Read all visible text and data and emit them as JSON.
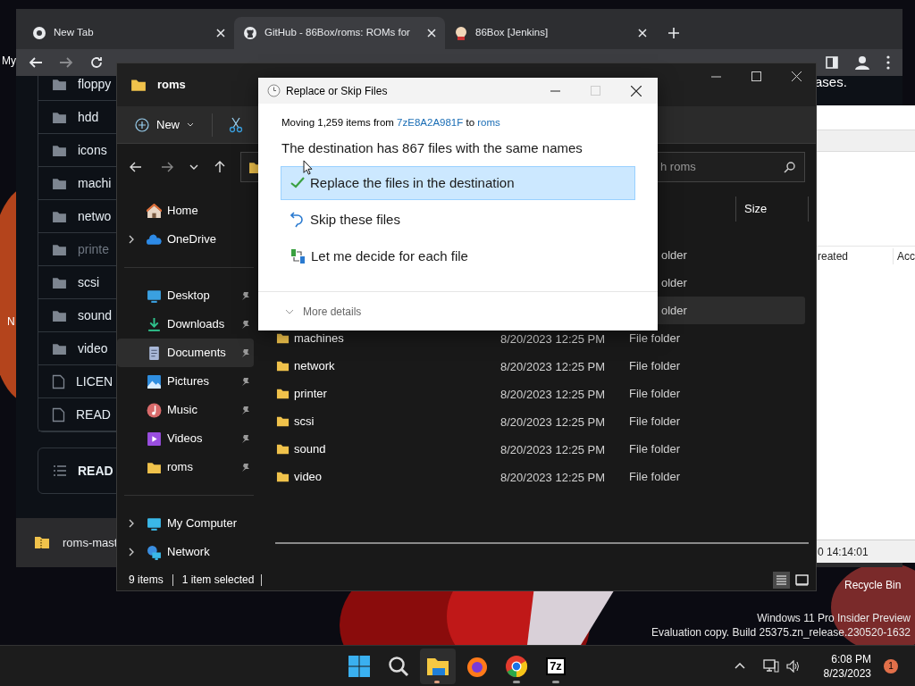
{
  "desktop": {
    "icons": [
      {
        "label": "My"
      },
      {
        "label": "N"
      },
      {
        "label": "Recycle Bin"
      }
    ],
    "watermark": [
      "Windows 11 Pro Insider Preview",
      "Evaluation copy. Build 25375.zn_release.230520-1632"
    ]
  },
  "browser": {
    "tabs": [
      {
        "label": "New Tab",
        "kind": "chrome",
        "selected": false
      },
      {
        "label": "GitHub - 86Box/roms: ROMs for",
        "kind": "github",
        "selected": true
      },
      {
        "label": "86Box [Jenkins]",
        "kind": "jenkins",
        "selected": false
      }
    ],
    "page_text": "ases.",
    "files": [
      {
        "name": "floppy",
        "kind": "folder",
        "dimmed": false
      },
      {
        "name": "hdd",
        "kind": "folder",
        "dimmed": false
      },
      {
        "name": "icons",
        "kind": "folder",
        "dimmed": false
      },
      {
        "name": "machi",
        "kind": "folder",
        "dimmed": false
      },
      {
        "name": "netwo",
        "kind": "folder",
        "dimmed": false
      },
      {
        "name": "printe",
        "kind": "folder",
        "dimmed": true
      },
      {
        "name": "scsi",
        "kind": "folder",
        "dimmed": false
      },
      {
        "name": "sound",
        "kind": "folder",
        "dimmed": false
      },
      {
        "name": "video",
        "kind": "folder",
        "dimmed": false
      },
      {
        "name": "LICEN",
        "kind": "file",
        "dimmed": false
      },
      {
        "name": "READ",
        "kind": "file",
        "dimmed": false
      }
    ],
    "readme_header": "READ",
    "download": "roms-mast"
  },
  "archive_window": {
    "columns": [
      "reated",
      "Acc"
    ],
    "status": "0 14:14:01"
  },
  "explorer": {
    "title": "roms",
    "new_button": "New",
    "search_placeholder": "h roms",
    "size_column": "Size",
    "nav": [
      {
        "label": "Home",
        "kind": "home",
        "expandable": false,
        "pinned": false,
        "selected": false
      },
      {
        "label": "OneDrive",
        "kind": "cloud",
        "expandable": true,
        "pinned": false,
        "selected": false
      },
      {
        "label": "Desktop",
        "kind": "desktop",
        "expandable": false,
        "pinned": true,
        "selected": false
      },
      {
        "label": "Downloads",
        "kind": "download",
        "expandable": false,
        "pinned": true,
        "selected": false
      },
      {
        "label": "Documents",
        "kind": "document",
        "expandable": false,
        "pinned": true,
        "selected": true
      },
      {
        "label": "Pictures",
        "kind": "picture",
        "expandable": false,
        "pinned": true,
        "selected": false
      },
      {
        "label": "Music",
        "kind": "music",
        "expandable": false,
        "pinned": true,
        "selected": false
      },
      {
        "label": "Videos",
        "kind": "video",
        "expandable": false,
        "pinned": true,
        "selected": false
      },
      {
        "label": "roms",
        "kind": "folder",
        "expandable": false,
        "pinned": true,
        "selected": false
      },
      {
        "label": "My Computer",
        "kind": "computer",
        "expandable": true,
        "pinned": false,
        "selected": false
      },
      {
        "label": "Network",
        "kind": "network",
        "expandable": true,
        "pinned": false,
        "selected": false
      }
    ],
    "rows": [
      {
        "type": "older",
        "selected": false
      },
      {
        "type": "older",
        "selected": false
      },
      {
        "type": "older",
        "selected": true
      },
      {
        "name": "machines",
        "date": "8/20/2023 12:25 PM",
        "type": "File folder",
        "selected": false
      },
      {
        "name": "network",
        "date": "8/20/2023 12:25 PM",
        "type": "File folder",
        "selected": false
      },
      {
        "name": "printer",
        "date": "8/20/2023 12:25 PM",
        "type": "File folder",
        "selected": false
      },
      {
        "name": "scsi",
        "date": "8/20/2023 12:25 PM",
        "type": "File folder",
        "selected": false
      },
      {
        "name": "sound",
        "date": "8/20/2023 12:25 PM",
        "type": "File folder",
        "selected": false
      },
      {
        "name": "video",
        "date": "8/20/2023 12:25 PM",
        "type": "File folder",
        "selected": false
      }
    ],
    "status": [
      "9 items",
      "1 item selected"
    ]
  },
  "dialog": {
    "title": "Replace or Skip Files",
    "moving": [
      "Moving 1,259 items from",
      "7zE8A2A981F",
      "to",
      "roms"
    ],
    "heading": "The destination has 867 files with the same names",
    "options": [
      {
        "label": "Replace the files in the destination",
        "kind": "replace",
        "selected": true
      },
      {
        "label": "Skip these files",
        "kind": "skip",
        "selected": false
      },
      {
        "label": "Let me decide for each file",
        "kind": "decide",
        "selected": false
      }
    ],
    "more_details": "More details"
  },
  "taskbar": {
    "apps": [
      {
        "kind": "start",
        "running": false,
        "selected": false
      },
      {
        "kind": "search",
        "running": false,
        "selected": false
      },
      {
        "kind": "explorer",
        "running": true,
        "selected": true
      },
      {
        "kind": "firefox",
        "running": false,
        "selected": false
      },
      {
        "kind": "chrome",
        "running": true,
        "selected": false
      },
      {
        "kind": "7z",
        "running": true,
        "selected": false
      }
    ],
    "time": "6:08 PM",
    "date": "8/23/2023",
    "badge": "1"
  }
}
